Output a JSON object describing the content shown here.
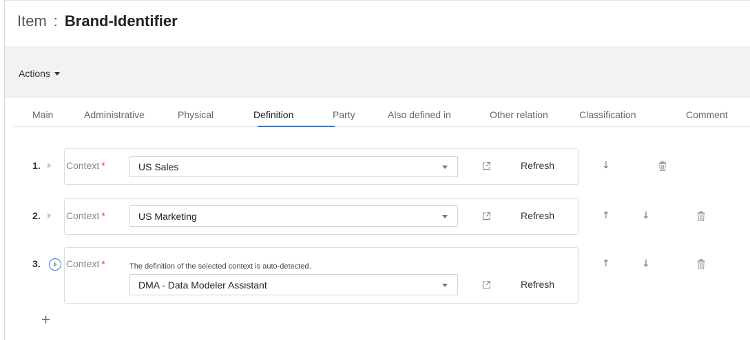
{
  "header": {
    "title_prefix": "Item",
    "title_separator": ":",
    "title_name": "Brand-Identifier"
  },
  "actions": {
    "label": "Actions"
  },
  "tabs": [
    {
      "label": "Main",
      "active": false
    },
    {
      "label": "Administrative",
      "active": false
    },
    {
      "label": "Physical",
      "active": false
    },
    {
      "label": "Definition",
      "active": true
    },
    {
      "label": "Party",
      "active": false
    },
    {
      "label": "Also defined in",
      "active": false
    },
    {
      "label": "Other relation",
      "active": false
    },
    {
      "label": "Classification",
      "active": false
    },
    {
      "label": "Comment",
      "active": false
    }
  ],
  "rows": [
    {
      "number": "1.",
      "context_label": "Context",
      "required_mark": "*",
      "value": "US Sales",
      "note": "",
      "refresh_label": "Refresh"
    },
    {
      "number": "2.",
      "context_label": "Context",
      "required_mark": "*",
      "value": "US Marketing",
      "note": "",
      "refresh_label": "Refresh"
    },
    {
      "number": "3.",
      "context_label": "Context",
      "required_mark": "*",
      "value": "DMA - Data Modeler Assistant",
      "note": "The definition of the selected context is auto-detected.",
      "refresh_label": "Refresh"
    }
  ],
  "icons": {
    "up": "↑",
    "down": "↓",
    "add": "+"
  },
  "colors": {
    "accent": "#2b7de1",
    "required": "#e0303a",
    "actions_bar_bg": "#f2f2f2"
  }
}
